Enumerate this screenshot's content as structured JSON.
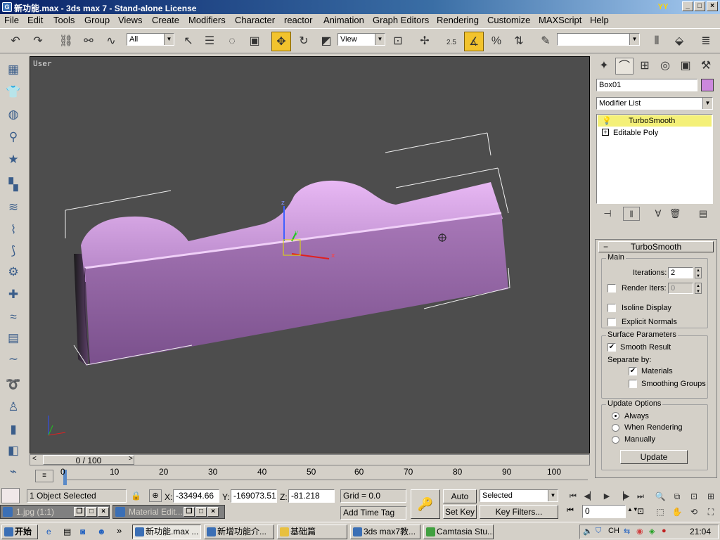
{
  "window": {
    "title": "新功能.max - 3ds max 7 - Stand-alone License",
    "app_icon": "3ds-max-logo",
    "logo_icon": "yellow-logo-graphic",
    "min_label": "_",
    "max_label": "□",
    "close_label": "×"
  },
  "menu": [
    "File",
    "Edit",
    "Tools",
    "Group",
    "Views",
    "Create",
    "Modifiers",
    "Character",
    "reactor",
    "Animation",
    "Graph Editors",
    "Rendering",
    "Customize",
    "MAXScript",
    "Help"
  ],
  "toolbar": {
    "filter_value": "All",
    "ref_coord_value": "View",
    "snap_label": "2.5",
    "percent_label": "%",
    "named_selection_value": ""
  },
  "viewport": {
    "label": "User",
    "object_color": "#b07fc0"
  },
  "time": {
    "frame_display": "0 / 100",
    "ticks": [
      "0",
      "10",
      "20",
      "30",
      "40",
      "50",
      "60",
      "70",
      "80",
      "90",
      "100"
    ]
  },
  "command_panel": {
    "object_name": "Box01",
    "object_color": "#cc88dd",
    "modifier_list_label": "Modifier List",
    "stack": [
      {
        "label": "TurboSmooth",
        "selected": true
      },
      {
        "label": "Editable Poly",
        "selected": false
      }
    ],
    "turbosmooth": {
      "rollout_title": "TurboSmooth",
      "main_group": "Main",
      "iterations_label": "Iterations:",
      "iterations_value": "2",
      "render_iters_label": "Render Iters:",
      "render_iters_value": "0",
      "render_iters_checked": false,
      "isoline_label": "Isoline Display",
      "isoline_checked": false,
      "explicit_normals_label": "Explicit Normals",
      "explicit_normals_checked": false,
      "surface_group": "Surface Parameters",
      "smooth_result_label": "Smooth Result",
      "smooth_result_checked": true,
      "separate_by_label": "Separate by:",
      "materials_label": "Materials",
      "materials_checked": true,
      "smoothing_groups_label": "Smoothing Groups",
      "smoothing_groups_checked": false,
      "update_group": "Update Options",
      "always_label": "Always",
      "when_rendering_label": "When Rendering",
      "manually_label": "Manually",
      "update_mode": "Always",
      "update_button": "Update"
    }
  },
  "status": {
    "selection_text": "1 Object Selected",
    "x_label": "X:",
    "x_value": "-33494.66",
    "y_label": "Y:",
    "y_value": "-169073.51",
    "z_label": "Z:",
    "z_value": "-81.218",
    "grid_text": "Grid = 0.0",
    "add_time_tag": "Add Time Tag",
    "auto_key": "Auto Key",
    "set_key": "Set Key",
    "selected_value": "Selected",
    "key_filters": "Key Filters...",
    "current_frame": "0"
  },
  "mini_windows": [
    {
      "label": "1.jpg (1:1)"
    },
    {
      "label": "Material Edit..."
    }
  ],
  "taskbar": {
    "start_label": "开始",
    "tasks": [
      {
        "label": "新功能.max ...",
        "active": true
      },
      {
        "label": "新增功能介..."
      },
      {
        "label": "基础篇"
      },
      {
        "label": "3ds max7教..."
      },
      {
        "label": "Camtasia Stu..."
      }
    ],
    "clock": "21:04"
  }
}
